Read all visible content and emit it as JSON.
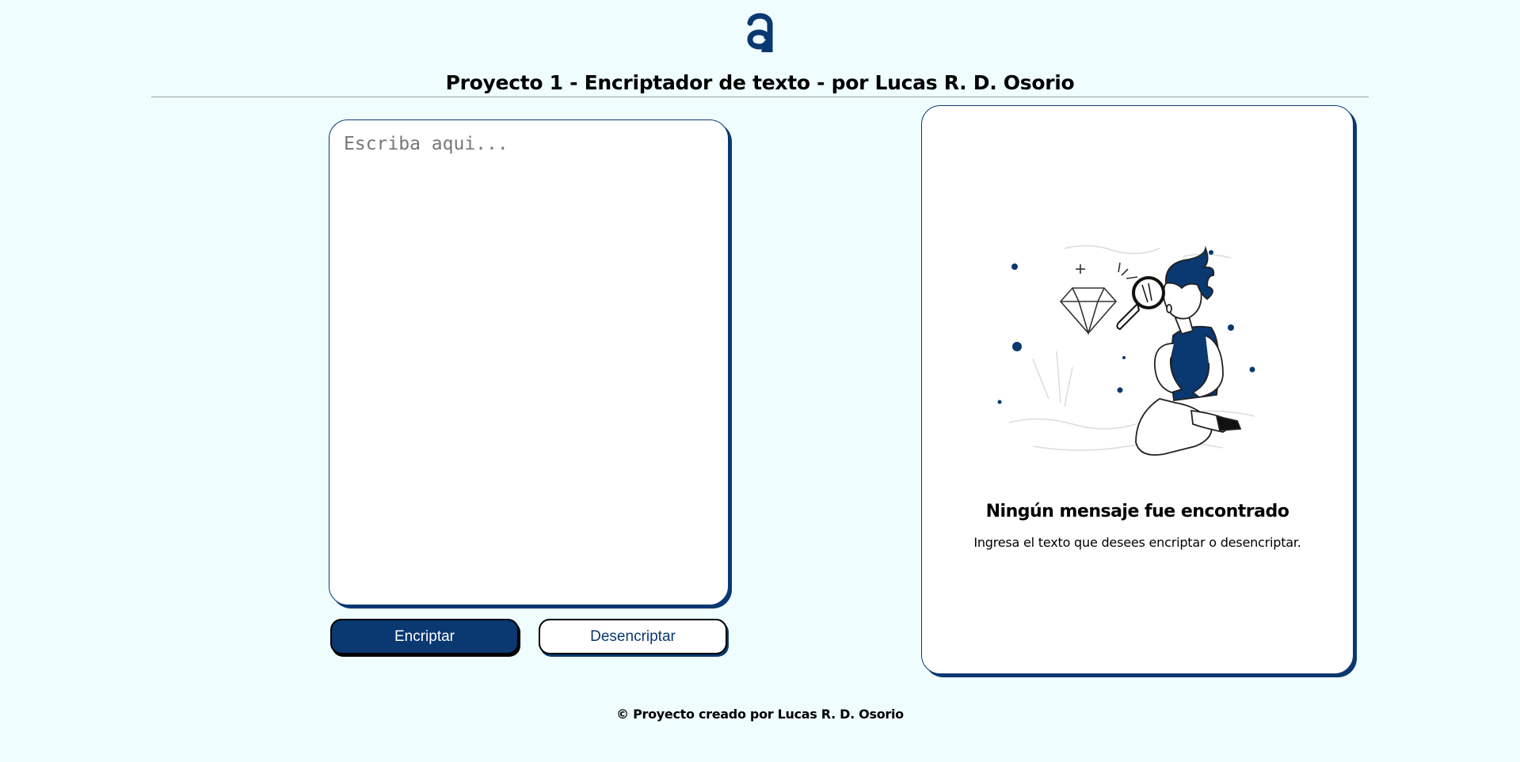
{
  "header": {
    "logo_icon": "alura-a-logo-icon",
    "title": "Proyecto 1 - Encriptador de texto - por Lucas R. D. Osorio"
  },
  "input": {
    "placeholder": "Escriba aqui...",
    "value": ""
  },
  "buttons": {
    "encrypt_label": "Encriptar",
    "decrypt_label": "Desencriptar"
  },
  "output": {
    "illustration": "person-searching-diamond-illustration",
    "empty_title": "Ningún mensaje fue encontrado",
    "empty_subtitle": "Ingresa el texto que desees encriptar o desencriptar."
  },
  "footer": {
    "text": "© Proyecto creado por Lucas R. D. Osorio"
  },
  "colors": {
    "background": "#effdff",
    "accent": "#0a3871",
    "card": "#ffffff",
    "divider": "#9aa4ab"
  }
}
